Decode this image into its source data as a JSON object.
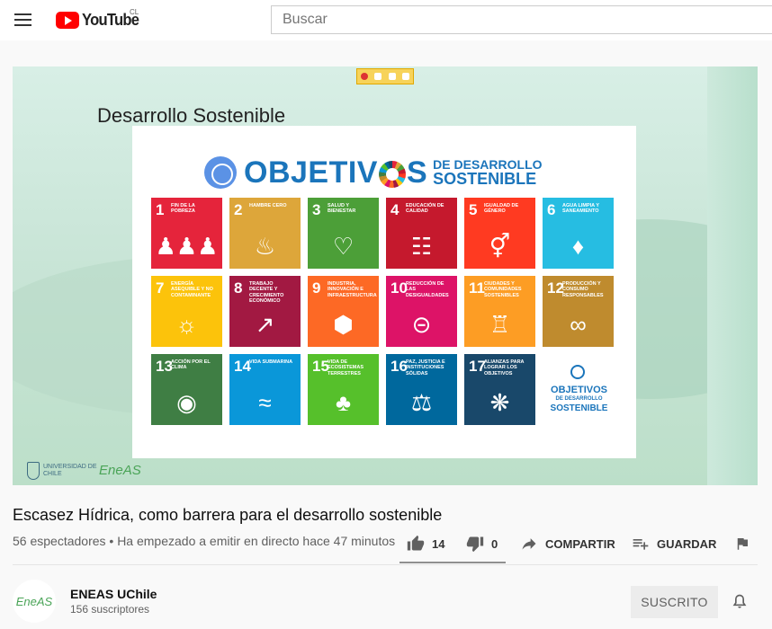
{
  "header": {
    "logo_text": "YouTube",
    "country_code": "CL",
    "search_placeholder": "Buscar"
  },
  "player": {
    "slide_title": "Desarrollo Sostenible",
    "poster_heading_1": "OBJETIV",
    "poster_heading_2": "S",
    "poster_sub_1": "DE DESARROLLO",
    "poster_sub_2": "SOSTENIBLE",
    "goals": [
      {
        "num": "1",
        "label": "Fin de la pobreza",
        "color": "#e5243b",
        "icon": "family-icon",
        "glyph": "♟♟♟"
      },
      {
        "num": "2",
        "label": "Hambre cero",
        "color": "#dda63a",
        "icon": "bowl-icon",
        "glyph": "♨"
      },
      {
        "num": "3",
        "label": "Salud y bienestar",
        "color": "#4c9f38",
        "icon": "heartbeat-icon",
        "glyph": "♡"
      },
      {
        "num": "4",
        "label": "Educación de calidad",
        "color": "#c5192d",
        "icon": "book-icon",
        "glyph": "☷"
      },
      {
        "num": "5",
        "label": "Igualdad de género",
        "color": "#ff3a21",
        "icon": "gender-icon",
        "glyph": "⚥"
      },
      {
        "num": "6",
        "label": "Agua limpia y saneamiento",
        "color": "#26bde2",
        "icon": "water-icon",
        "glyph": "♦"
      },
      {
        "num": "7",
        "label": "Energía asequible y no contaminante",
        "color": "#fcc30b",
        "icon": "sun-icon",
        "glyph": "☼"
      },
      {
        "num": "8",
        "label": "Trabajo decente y crecimiento económico",
        "color": "#a21942",
        "icon": "chart-icon",
        "glyph": "↗"
      },
      {
        "num": "9",
        "label": "Industria, innovación e infraestructura",
        "color": "#fd6925",
        "icon": "cubes-icon",
        "glyph": "⬢"
      },
      {
        "num": "10",
        "label": "Reducción de las desigualdades",
        "color": "#dd1367",
        "icon": "equal-icon",
        "glyph": "⊝"
      },
      {
        "num": "11",
        "label": "Ciudades y comunidades sostenibles",
        "color": "#fd9d24",
        "icon": "city-icon",
        "glyph": "♖"
      },
      {
        "num": "12",
        "label": "Producción y consumo responsables",
        "color": "#bf8b2e",
        "icon": "infinity-icon",
        "glyph": "∞"
      },
      {
        "num": "13",
        "label": "Acción por el clima",
        "color": "#3f7e44",
        "icon": "eye-globe-icon",
        "glyph": "◉"
      },
      {
        "num": "14",
        "label": "Vida submarina",
        "color": "#0a97d9",
        "icon": "fish-icon",
        "glyph": "≈"
      },
      {
        "num": "15",
        "label": "Vida de ecosistemas terrestres",
        "color": "#56c02b",
        "icon": "tree-icon",
        "glyph": "♣"
      },
      {
        "num": "16",
        "label": "Paz, justicia e instituciones sólidas",
        "color": "#00689d",
        "icon": "dove-icon",
        "glyph": "⚖"
      },
      {
        "num": "17",
        "label": "Alianzas para lograr los objetivos",
        "color": "#19486a",
        "icon": "rings-icon",
        "glyph": "❋"
      }
    ],
    "logo_tile": {
      "t1": "OBJETIVOS",
      "t2": "DE DESARROLLO",
      "t3": "SOSTENIBLE"
    },
    "university": "UNIVERSIDAD DE CHILE",
    "eneas_logo": "EneAS"
  },
  "video": {
    "title": "Escasez Hídrica, como barrera para el desarrollo sostenible",
    "meta": "56 espectadores • Ha empezado a emitir en directo hace 47 minutos",
    "like_count": "14",
    "dislike_count": "0",
    "like_ratio": 1.0,
    "share_label": "COMPARTIR",
    "save_label": "GUARDAR"
  },
  "channel": {
    "name": "ENEAS UChile",
    "subscribers": "156 suscriptores",
    "avatar_text": "EneAS",
    "subscribe_label": "SUSCRITO"
  }
}
